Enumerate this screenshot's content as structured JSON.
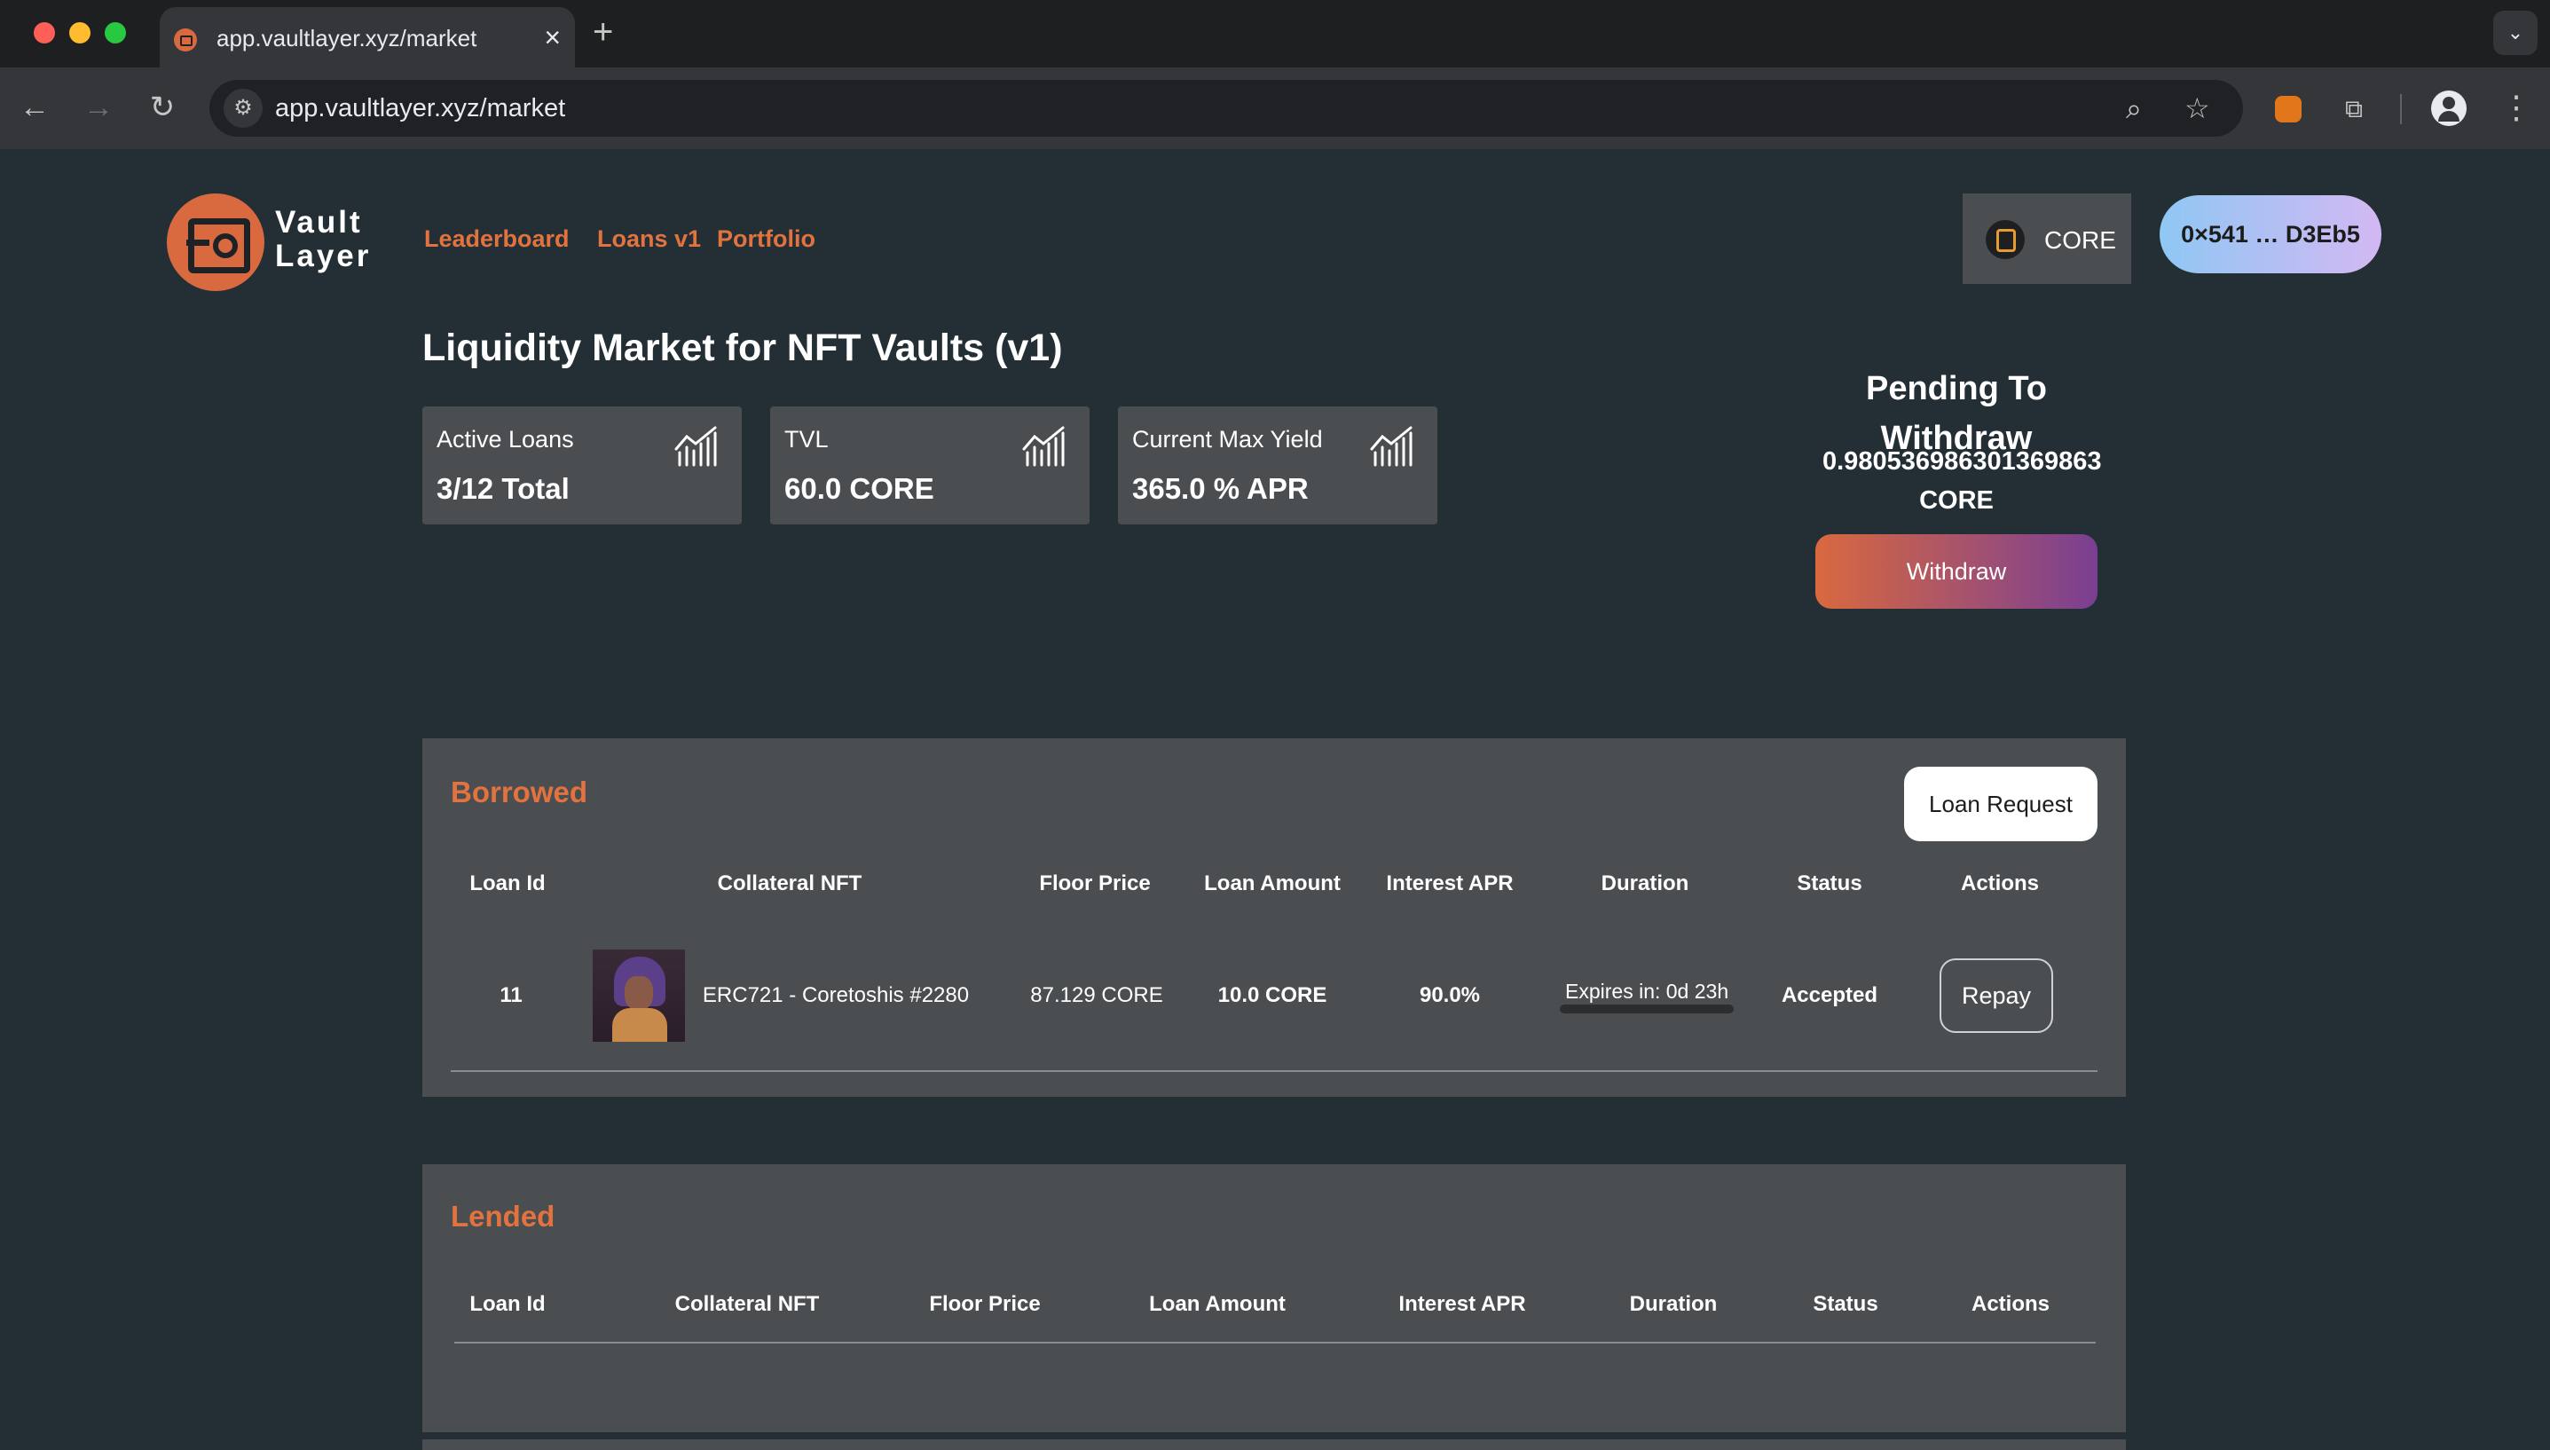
{
  "browser": {
    "tab_title": "app.vaultlayer.xyz/market",
    "url": "app.vaultlayer.xyz/market"
  },
  "brand": {
    "line1": "Vault",
    "line2": "Layer"
  },
  "nav": {
    "leaderboard": "Leaderboard",
    "loans": "Loans v1",
    "portfolio": "Portfolio"
  },
  "network": {
    "label": "CORE"
  },
  "wallet": {
    "address": "0×541 … D3Eb5"
  },
  "page": {
    "title": "Liquidity Market for NFT Vaults (v1)"
  },
  "stats": [
    {
      "label": "Active Loans",
      "value": "3/12 Total"
    },
    {
      "label": "TVL",
      "value": "60.0 CORE"
    },
    {
      "label": "Current Max Yield",
      "value": "365.0 % APR"
    }
  ],
  "pending": {
    "title": "Pending To Withdraw",
    "amount": "0.980536986301369863",
    "unit": "CORE",
    "withdraw_label": "Withdraw"
  },
  "borrowed": {
    "title": "Borrowed",
    "loan_request_label": "Loan Request",
    "columns": [
      "Loan Id",
      "Collateral NFT",
      "Floor Price",
      "Loan Amount",
      "Interest APR",
      "Duration",
      "Status",
      "Actions"
    ],
    "rows": [
      {
        "loan_id": "11",
        "nft": "ERC721 - Coretoshis #2280",
        "floor_price": "87.129 CORE",
        "loan_amount": "10.0 CORE",
        "interest_apr": "90.0%",
        "duration": "Expires in: 0d 23h",
        "status": "Accepted",
        "action": "Repay"
      }
    ]
  },
  "lended": {
    "title": "Lended",
    "columns": [
      "Loan Id",
      "Collateral NFT",
      "Floor Price",
      "Loan Amount",
      "Interest APR",
      "Duration",
      "Status",
      "Actions"
    ]
  },
  "colors": {
    "accent": "#e2733f",
    "background": "#232f35",
    "panel": "#4b4e51",
    "wallet_gradient_start": "#8fc7f3",
    "wallet_gradient_end": "#d3b8f3",
    "withdraw_gradient_start": "#d9693f",
    "withdraw_gradient_end": "#7a3f93"
  }
}
